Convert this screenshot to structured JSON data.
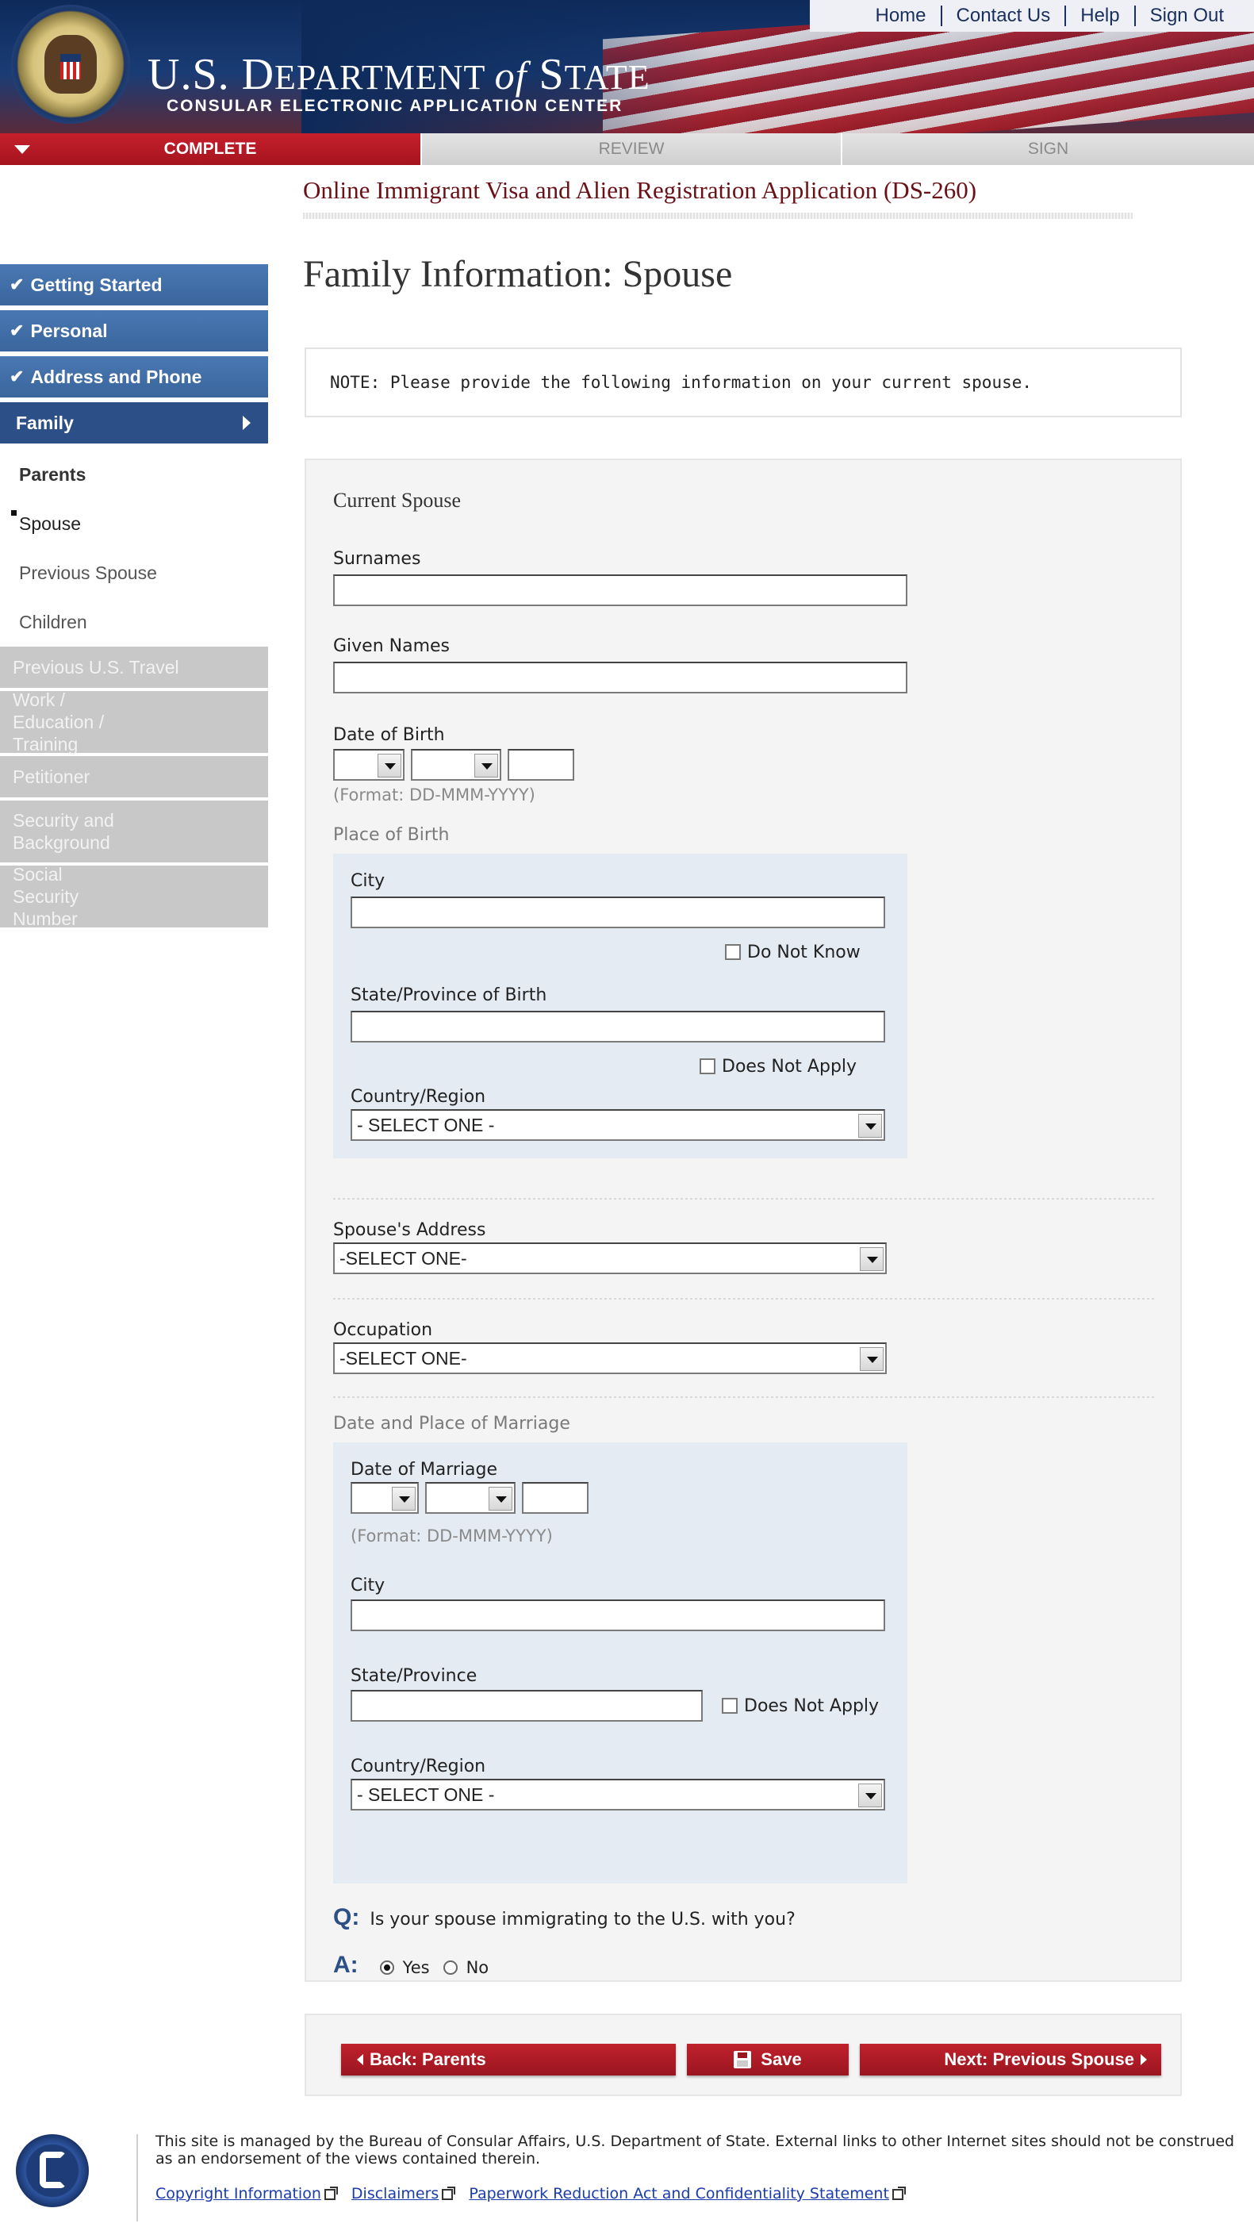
{
  "header": {
    "topnav": [
      "Home",
      "Contact Us",
      "Help",
      "Sign Out"
    ],
    "title_us": "U.S. D",
    "title_ept": "EPARTMENT ",
    "title_of": "of",
    "title_s": " S",
    "title_tate": "TATE",
    "subtitle": "CONSULAR ELECTRONIC APPLICATION CENTER"
  },
  "progress": {
    "complete": "COMPLETE",
    "review": "REVIEW",
    "sign": "SIGN"
  },
  "app_title": "Online Immigrant Visa and Alien Registration Application (DS-260)",
  "sidebar": {
    "done": [
      "Getting Started",
      "Personal",
      "Address and Phone"
    ],
    "active": "Family",
    "sub": [
      "Parents",
      "Spouse",
      "Previous Spouse",
      "Children"
    ],
    "disabled": [
      "Previous U.S. Travel",
      "Work / Education / Training",
      "Petitioner",
      "Security and Background",
      "Social Security Number"
    ]
  },
  "page_title": "Family Information: Spouse",
  "note": "NOTE: Please provide the following information on your current spouse.",
  "form": {
    "section_heading": "Current Spouse",
    "surnames": {
      "label": "Surnames",
      "value": ""
    },
    "given_names": {
      "label": "Given Names",
      "value": ""
    },
    "dob": {
      "label": "Date of Birth",
      "format": "(Format: DD-MMM-YYYY)"
    },
    "place_of_birth": {
      "label": "Place of Birth",
      "city": "City",
      "do_not_know": "Do Not Know",
      "state": "State/Province of Birth",
      "does_not_apply": "Does Not Apply",
      "country": "Country/Region",
      "country_value": "- SELECT ONE -"
    },
    "address": {
      "label": "Spouse's Address",
      "value": "-SELECT ONE-"
    },
    "occupation": {
      "label": "Occupation",
      "value": "-SELECT ONE-"
    },
    "marriage": {
      "label": "Date and Place of Marriage",
      "date_label": "Date of Marriage",
      "format": "(Format: DD-MMM-YYYY)",
      "city": "City",
      "state": "State/Province",
      "does_not_apply": "Does Not Apply",
      "country": "Country/Region",
      "country_value": "- SELECT ONE -"
    },
    "question": {
      "q_mark": "Q:",
      "text": "Is your spouse immigrating to the U.S. with you?",
      "a_mark": "A:",
      "yes": "Yes",
      "no": "No",
      "selected": "Yes"
    }
  },
  "actions": {
    "back": "Back: Parents",
    "save": "Save",
    "next": "Next: Previous Spouse"
  },
  "footer": {
    "text": "This site is managed by the Bureau of Consular Affairs, U.S. Department of State. External links to other Internet sites should not be construed as an endorsement of the views contained therein.",
    "links": [
      "Copyright Information",
      "Disclaimers",
      "Paperwork Reduction Act and Confidentiality Statement"
    ]
  },
  "colors": {
    "brand_red": "#a5141e",
    "nav_blue": "#3a659d",
    "title_red": "#6b1016"
  }
}
